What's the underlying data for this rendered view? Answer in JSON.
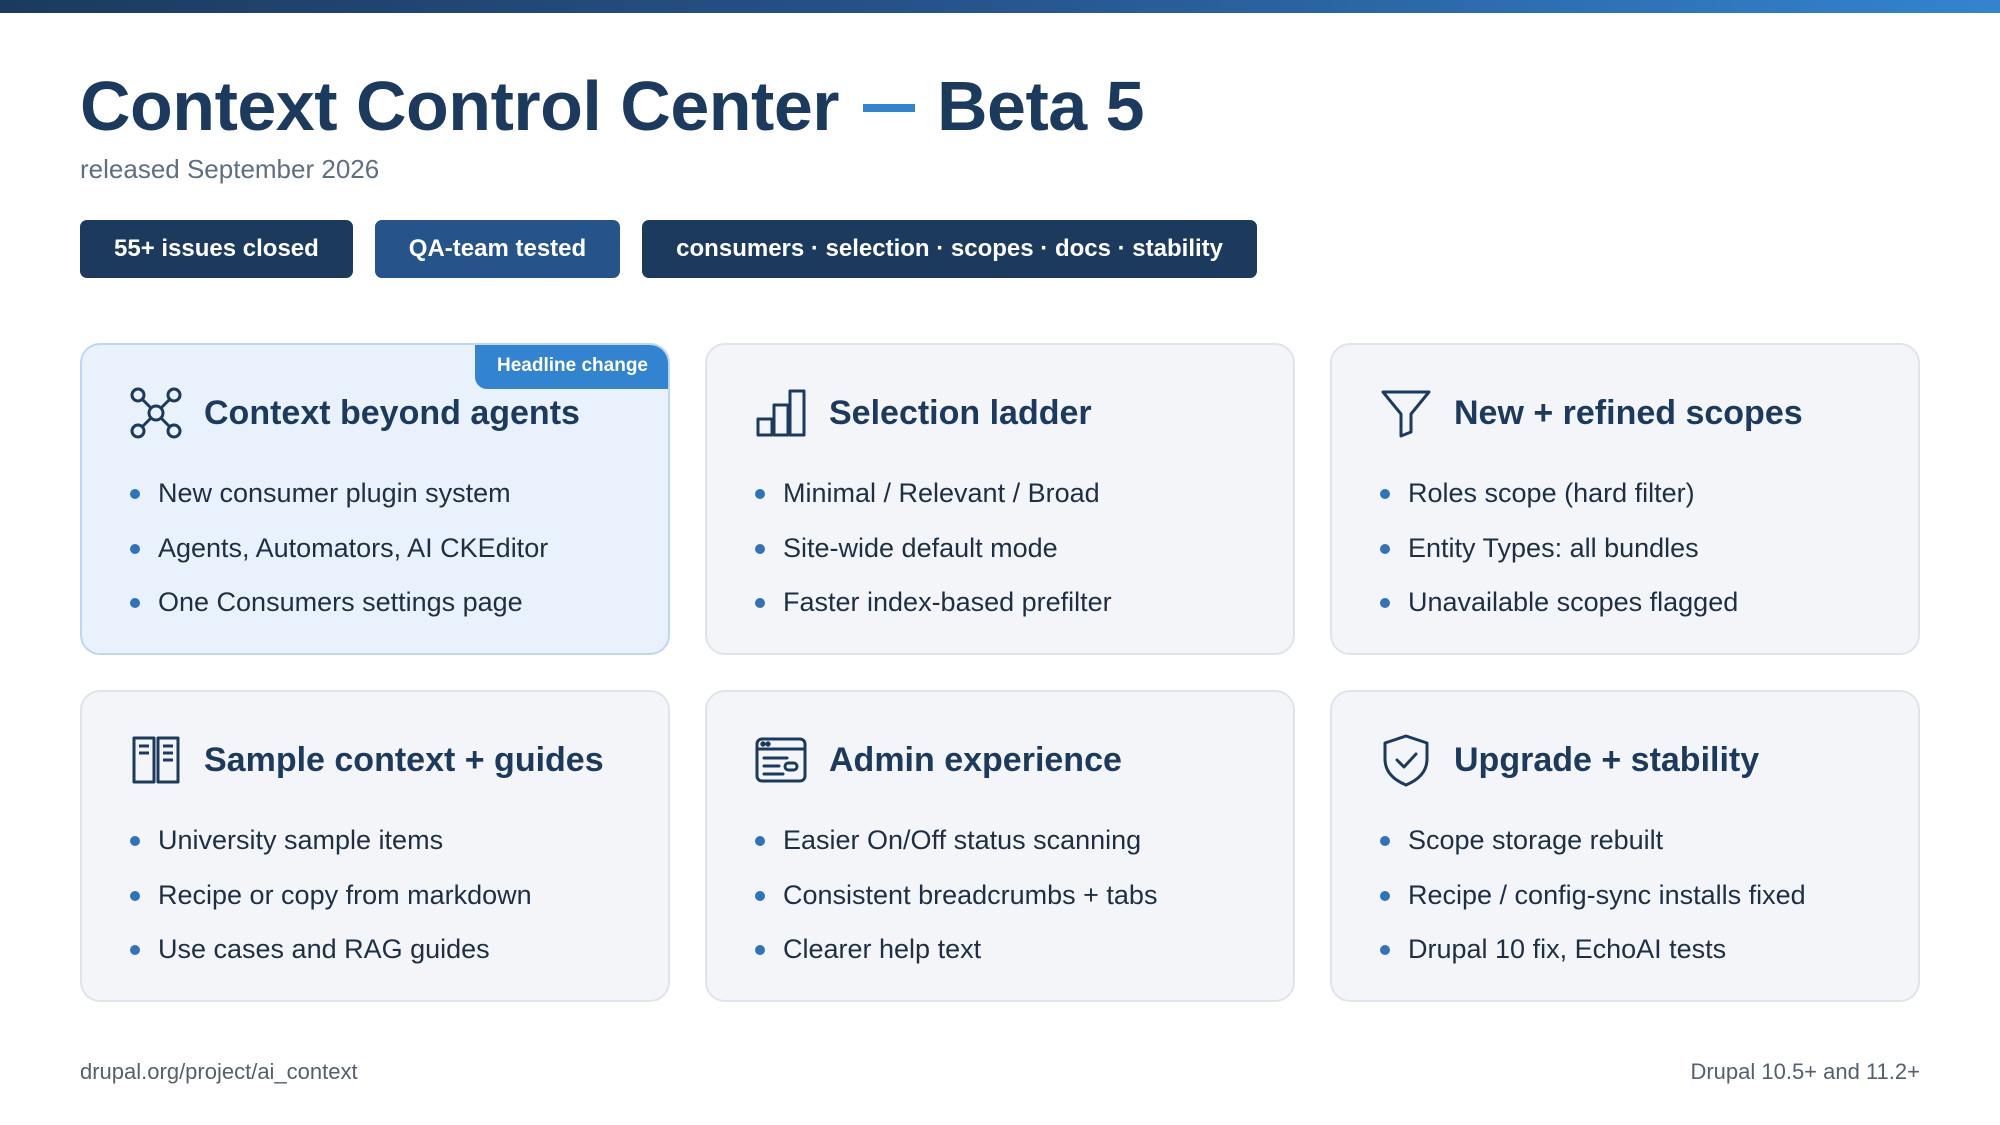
{
  "header": {
    "title_main": "Context Control Center",
    "title_version": "Beta 5",
    "subtitle": "released September 2026",
    "accent_color": "#3384d0",
    "brand_color": "#1c3a5e"
  },
  "pills": [
    {
      "label": "55+ issues closed"
    },
    {
      "label": "QA-team tested"
    },
    {
      "label": "consumers · selection · scopes · docs · stability"
    }
  ],
  "cards": [
    {
      "badge": "Headline change",
      "icon": "network-icon",
      "title": "Context beyond agents",
      "items": [
        "New consumer plugin system",
        "Agents, Automators, AI CKEditor",
        "One Consumers settings page"
      ]
    },
    {
      "icon": "bar-chart-icon",
      "title": "Selection ladder",
      "items": [
        "Minimal / Relevant / Broad",
        "Site-wide default mode",
        "Faster index-based prefilter"
      ]
    },
    {
      "icon": "filter-icon",
      "title": "New + refined scopes",
      "items": [
        "Roles scope (hard filter)",
        "Entity Types: all bundles",
        "Unavailable scopes flagged"
      ]
    },
    {
      "icon": "book-icon",
      "title": "Sample context + guides",
      "items": [
        "University sample items",
        "Recipe or copy from markdown",
        "Use cases and RAG guides"
      ]
    },
    {
      "icon": "admin-window-icon",
      "title": "Admin experience",
      "items": [
        "Easier On/Off status scanning",
        "Consistent breadcrumbs + tabs",
        "Clearer help text"
      ]
    },
    {
      "icon": "shield-check-icon",
      "title": "Upgrade + stability",
      "items": [
        "Scope storage rebuilt",
        "Recipe / config-sync installs fixed",
        "Drupal 10 fix, EchoAI tests"
      ]
    }
  ],
  "footer": {
    "link": "drupal.org/project/ai_context",
    "compatibility": "Drupal 10.5+ and 11.2+"
  }
}
